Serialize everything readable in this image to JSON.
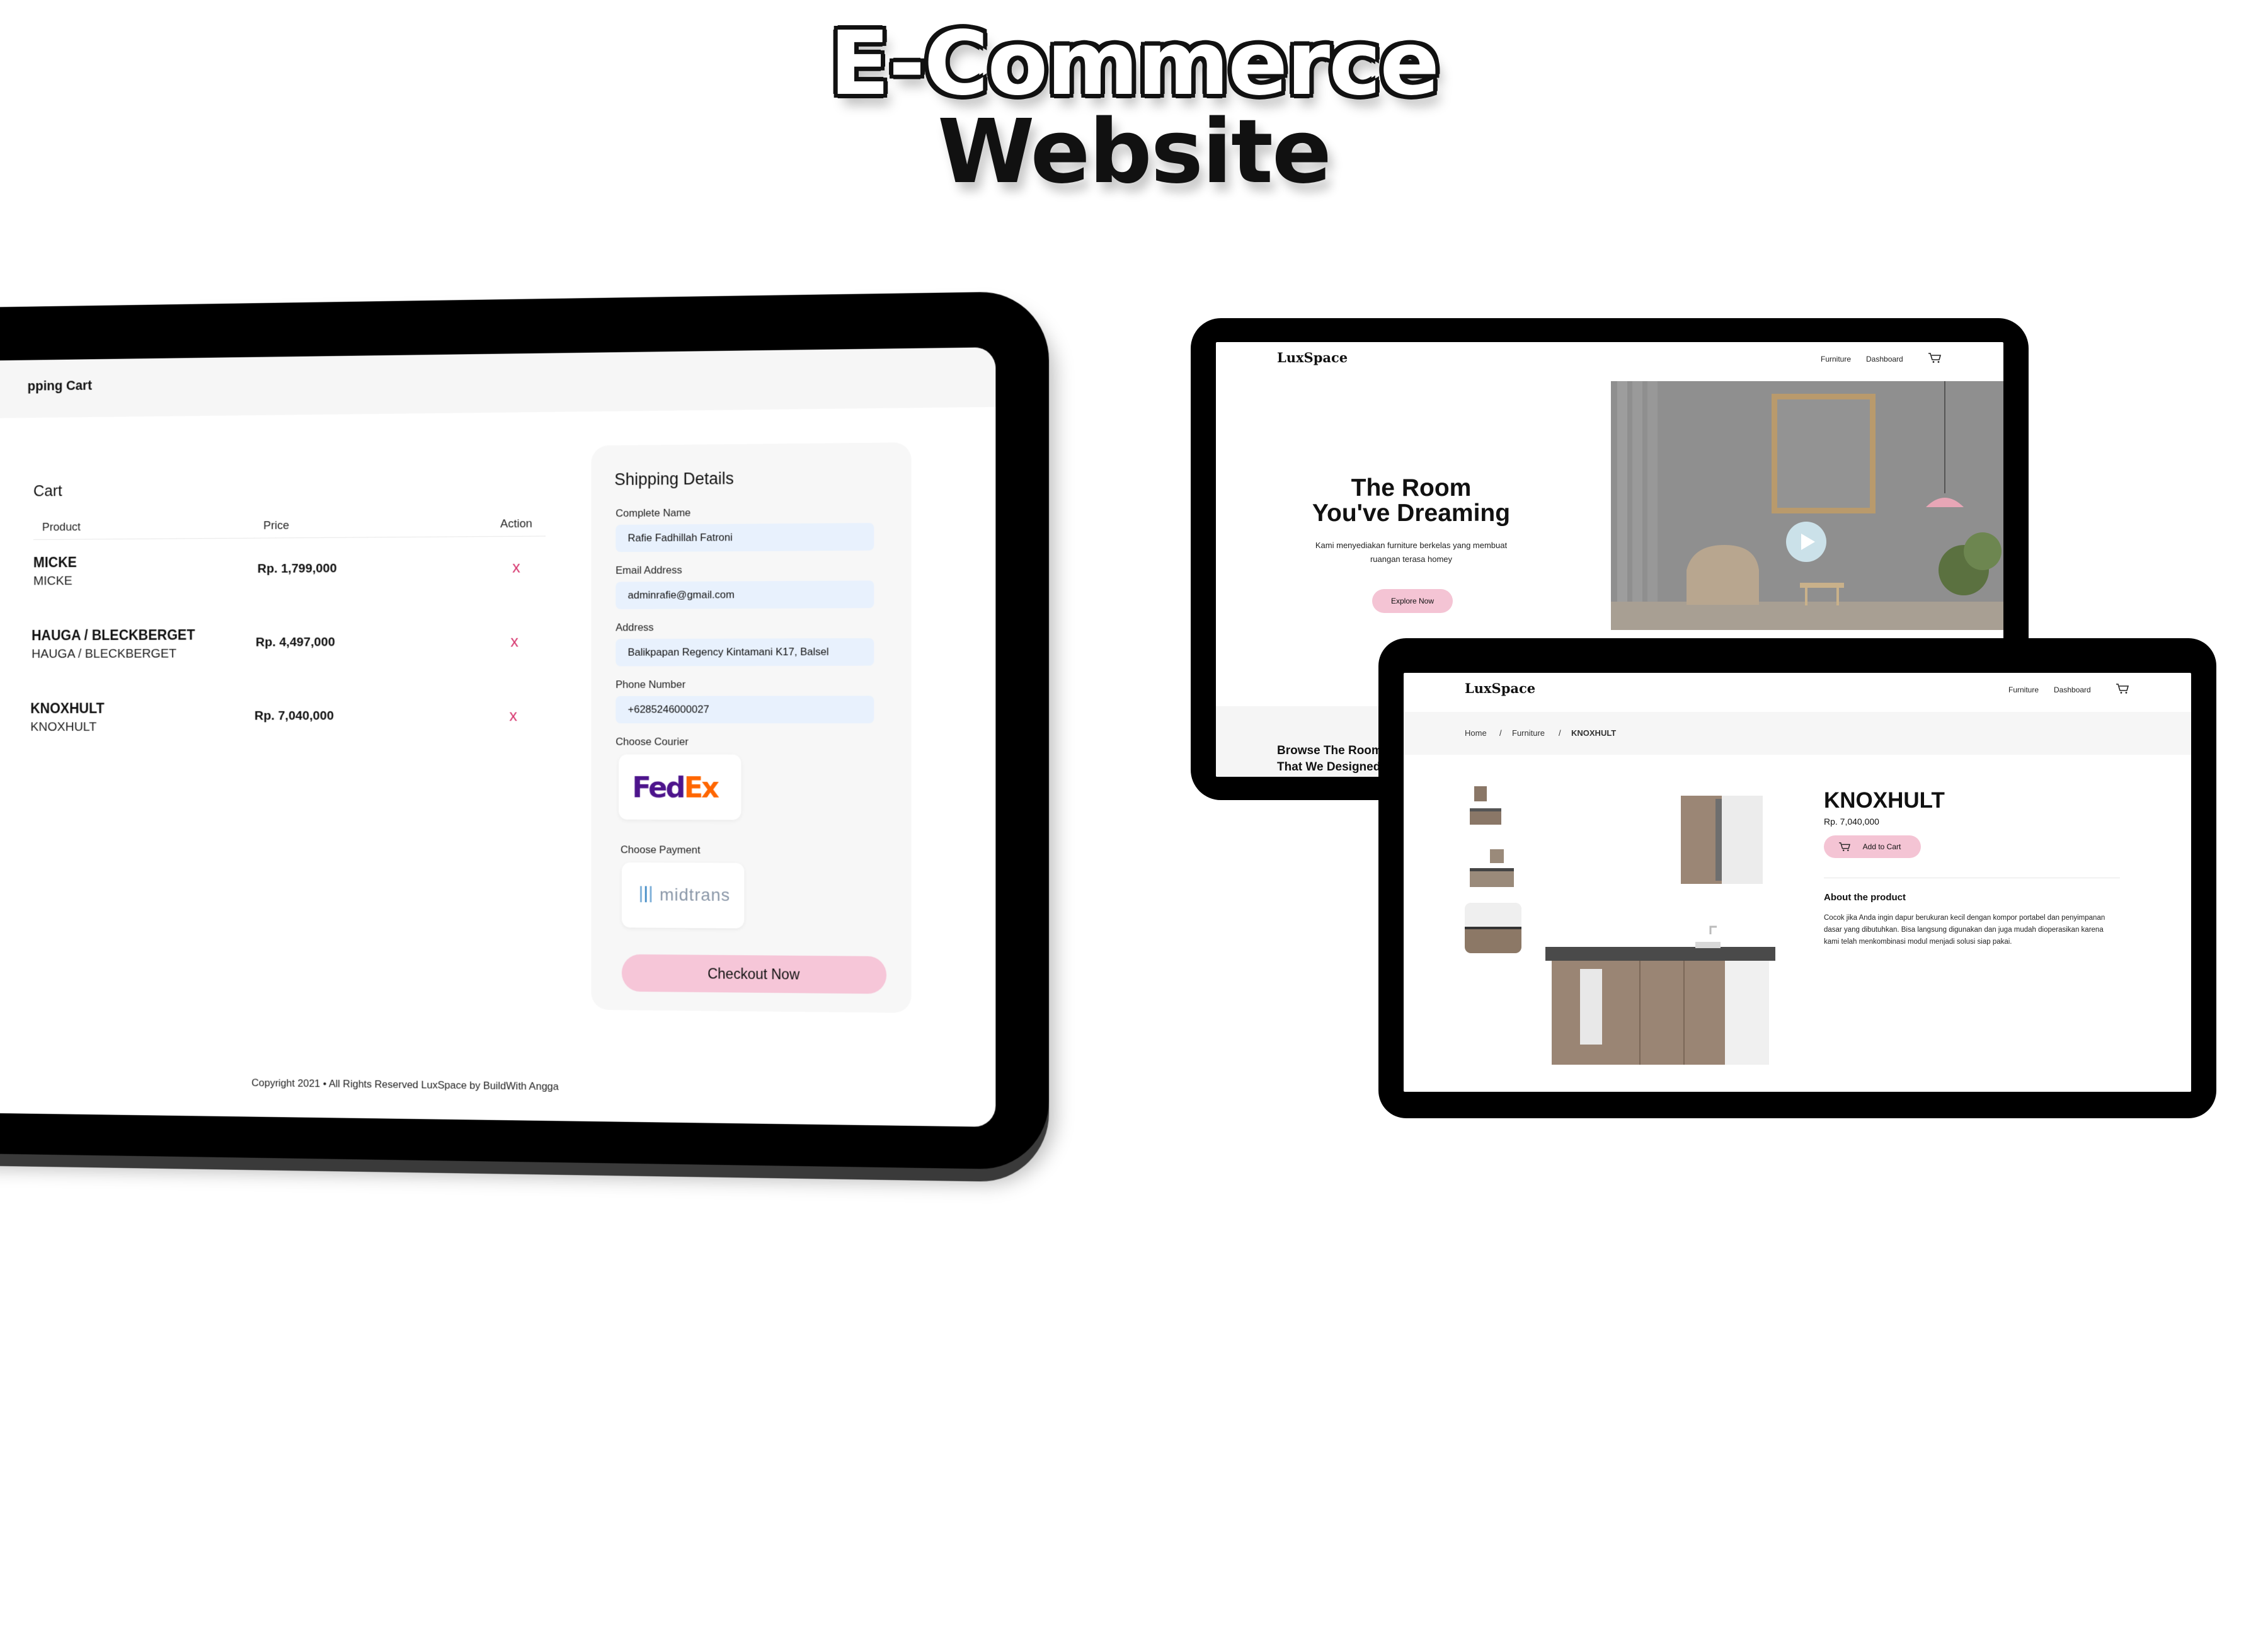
{
  "hero": {
    "line1": "E-Commerce",
    "line2": "Website"
  },
  "cart_page": {
    "topbar_title": "pping Cart",
    "heading": "Cart",
    "columns": {
      "product": "Product",
      "price": "Price",
      "action": "Action"
    },
    "items": [
      {
        "name": "MICKE",
        "sub": "MICKE",
        "price": "Rp. 1,799,000",
        "remove": "x"
      },
      {
        "name": "HAUGA / BLECKBERGET",
        "sub": "HAUGA / BLECKBERGET",
        "price": "Rp. 4,497,000",
        "remove": "x"
      },
      {
        "name": "KNOXHULT",
        "sub": "KNOXHULT",
        "price": "Rp. 7,040,000",
        "remove": "x"
      }
    ],
    "shipping": {
      "title": "Shipping Details",
      "name_label": "Complete Name",
      "name_value": "Rafie Fadhillah Fatroni",
      "email_label": "Email Address",
      "email_value": "adminrafie@gmail.com",
      "address_label": "Address",
      "address_value": "Balikpapan Regency Kintamani K17, Balsel",
      "phone_label": "Phone Number",
      "phone_value": "+6285246000027",
      "courier_label": "Choose Courier",
      "courier_fe": "Fed",
      "courier_ex": "Ex",
      "payment_label": "Choose Payment",
      "payment_name": "midtrans",
      "checkout_label": "Checkout Now"
    },
    "footer": "Copyright 2021 • All Rights Reserved LuxSpace by BuildWith Angga"
  },
  "home_page": {
    "logo": "LuxSpace",
    "nav": {
      "furniture": "Furniture",
      "dashboard": "Dashboard"
    },
    "hero_title_1": "The Room",
    "hero_title_2": "You've Dreaming",
    "hero_sub": "Kami menyediakan furniture berkelas yang membuat ruangan terasa homey",
    "explore_label": "Explore Now",
    "browse_1": "Browse The Room",
    "browse_2": "That We Designed"
  },
  "product_page": {
    "logo": "LuxSpace",
    "nav": {
      "furniture": "Furniture",
      "dashboard": "Dashboard"
    },
    "breadcrumb": {
      "home": "Home",
      "sep": "/",
      "category": "Furniture",
      "current": "KNOXHULT"
    },
    "title": "KNOXHULT",
    "price": "Rp. 7,040,000",
    "add_to_cart": "Add to Cart",
    "about_title": "About the product",
    "about_text": "Cocok jika Anda ingin dapur berukuran kecil dengan kompor portabel dan penyimpanan dasar yang dibutuhkan. Bisa langsung digunakan dan juga mudah dioperasikan karena kami telah menkombinasi modul menjadi solusi siap pakai."
  },
  "colors": {
    "accent_pink": "#f6c6d8",
    "input_blue": "#e8f1fd",
    "remove_red": "#d6336c",
    "fedex_purple": "#4d148c",
    "fedex_orange": "#ff6600"
  }
}
